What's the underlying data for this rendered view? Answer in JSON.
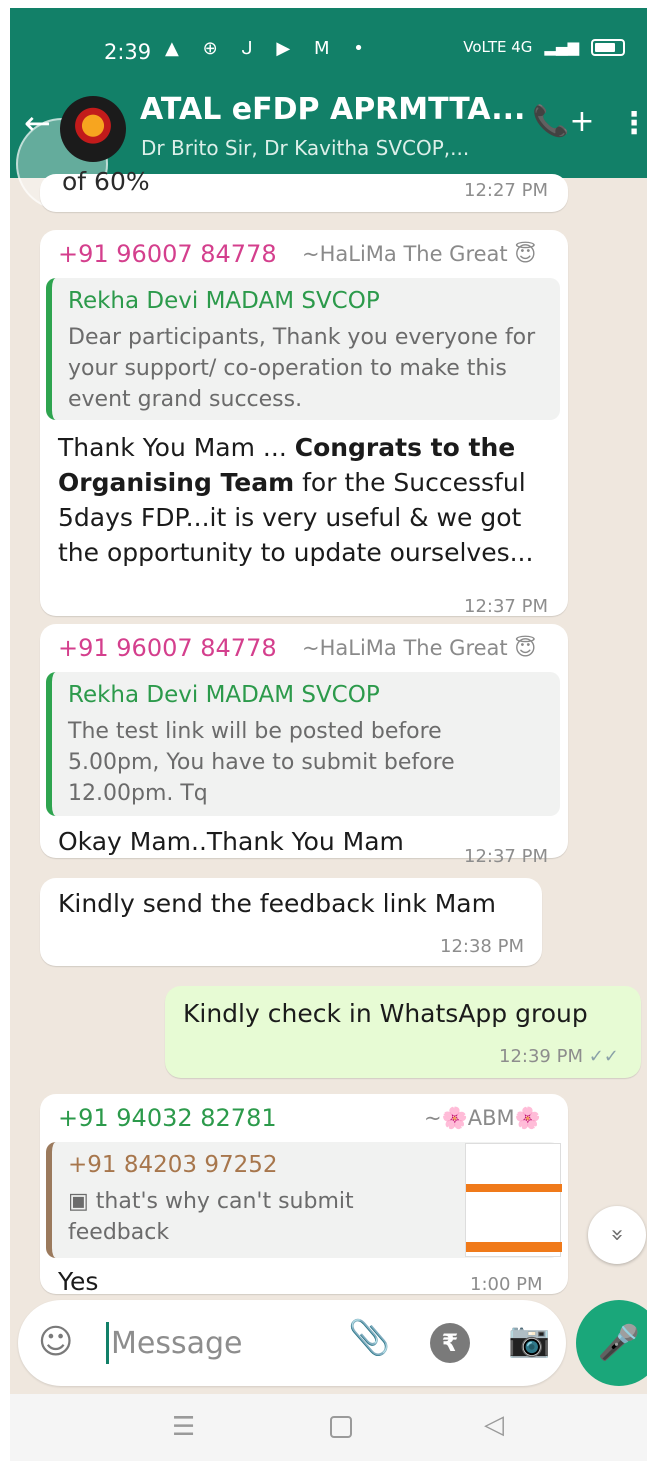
{
  "status_bar": {
    "time": "2:39",
    "left_icons": "▲ ⊕ ᒍ ▶ M •",
    "network": "VoLTE 4G",
    "battery_icon": "battery-icon"
  },
  "header": {
    "title": "ATAL eFDP APRMTTA...",
    "subtitle": "Dr Brito Sir, Dr Kavitha SVCOP,...",
    "back_icon": "←",
    "call_icon": "📞+",
    "menu_icon": "⋮"
  },
  "messages": [
    {
      "type": "partial",
      "text": "of 60%",
      "time": "12:27 PM"
    },
    {
      "type": "incoming",
      "sender": "+91 96007 84778",
      "sender_color": "#d43f8d",
      "nickname": "~HaLiMa The Great 😇",
      "quote": {
        "name": "Rekha Devi  MADAM SVCOP",
        "text": "Dear participants, Thank you everyone for your support/ co-operation to make this event grand success."
      },
      "text_parts": [
        "Thank You  Mam ... ",
        "Congrats to the Organising Team",
        " for the Successful 5days FDP...it is very useful & we got the opportunity to update ourselves..."
      ],
      "time": "12:37 PM"
    },
    {
      "type": "incoming",
      "sender": "+91 96007 84778",
      "sender_color": "#d43f8d",
      "nickname": "~HaLiMa The Great 😇",
      "quote": {
        "name": "Rekha Devi  MADAM SVCOP",
        "text": "The test link will be posted before 5.00pm, You have to submit before 12.00pm. Tq"
      },
      "text": "Okay Mam..Thank You Mam",
      "time": "12:37 PM"
    },
    {
      "type": "incoming",
      "text": "Kindly send the feedback link Mam",
      "time": "12:38 PM"
    },
    {
      "type": "outgoing",
      "text": "Kindly check in WhatsApp group",
      "time": "12:39 PM",
      "ticks": "✓✓"
    },
    {
      "type": "incoming",
      "sender": "+91 94032 82781",
      "sender_color": "#2c9a4b",
      "nickname": "~🌸ABM🌸",
      "quote": {
        "name": "+91 84203 97252",
        "text": "▣ that's why can't submit feedback"
      },
      "text": "Yes",
      "time": "1:00 PM"
    }
  ],
  "composer": {
    "placeholder": "Message",
    "emoji_icon": "☺",
    "attach_icon": "📎",
    "rupee_icon": "₹",
    "camera_icon": "📷",
    "mic_icon": "🎤"
  },
  "scroll_button": "»",
  "nav": {
    "menu": "☰",
    "back": "◁"
  },
  "colors": {
    "header": "#128068",
    "chat_bg": "#efe7de",
    "outgoing_bubble": "#e7fbd4",
    "accent_green": "#1aa77a"
  }
}
